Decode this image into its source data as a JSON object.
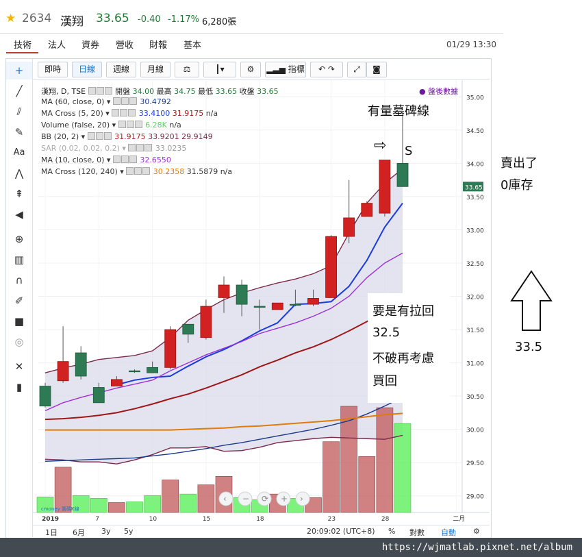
{
  "header": {
    "star_icon": "star-icon",
    "stock_code": "2634",
    "stock_name": "漢翔",
    "price": "33.65",
    "change": "-0.40",
    "change_pct": "-1.17%",
    "volume": "6,280張",
    "datetime": "01/29 13:30"
  },
  "tabs": [
    "技術",
    "法人",
    "資券",
    "營收",
    "財報",
    "基本"
  ],
  "toolbar": {
    "periods": [
      "即時",
      "日線",
      "週線",
      "月線"
    ],
    "indicator_label": "指標",
    "active_period": "日線"
  },
  "chart_header": {
    "symbol": "漢翔, D, TSE",
    "ohlc_labels": [
      "開盤",
      "最高",
      "最低",
      "收盤"
    ],
    "ohlc_values": [
      "34.00",
      "34.75",
      "33.65",
      "33.65"
    ],
    "compare_label": "盤後數據"
  },
  "indicators": [
    {
      "name": "MA (60, close, 0)",
      "values": [
        "30.4792"
      ],
      "colors": [
        "#1a3a8a"
      ]
    },
    {
      "name": "MA Cross (5, 20)",
      "values": [
        "33.4100",
        "31.9175",
        "n/a"
      ],
      "colors": [
        "#1a3adf",
        "#a01515",
        "#333333"
      ]
    },
    {
      "name": "Volume (false, 20)",
      "values": [
        "6.28K",
        "n/a"
      ],
      "colors": [
        "#5cd65c",
        "#333333"
      ]
    },
    {
      "name": "BB (20, 2)",
      "values": [
        "31.9175",
        "33.9201",
        "29.9149"
      ],
      "colors": [
        "#b22222",
        "#7a2a4a",
        "#7a2a4a"
      ]
    },
    {
      "name": "SAR (0.02, 0.02, 0.2)",
      "values": [
        "33.0235"
      ],
      "colors": [
        "#9a9a9a"
      ]
    },
    {
      "name": "MA (10, close, 0)",
      "values": [
        "32.6550"
      ],
      "colors": [
        "#9b30d9"
      ]
    },
    {
      "name": "MA Cross (120, 240)",
      "values": [
        "30.2358",
        "31.5879",
        "n/a"
      ],
      "colors": [
        "#e07b0a",
        "#333333",
        "#333333"
      ]
    }
  ],
  "annotations": {
    "tombstone": "有量墓碑線",
    "s_mark": "S",
    "sold": "賣出了",
    "zero_stock": "0庫存",
    "pullback_lines": [
      "要是有拉回",
      "32.5",
      "不破再考慮",
      "買回"
    ],
    "up_target": "33.5"
  },
  "bottom_bar": {
    "ranges": [
      "1日",
      "6月",
      "3y",
      "5y"
    ],
    "time": "20:09:02 (UTC+8)",
    "percent": "%",
    "log": "對數",
    "auto": "自動"
  },
  "watermark": "https://wjmatlab.pixnet.net/album",
  "logo_text": "cmoney 籌碼K線",
  "chart_data": {
    "type": "candlestick",
    "price_axis": {
      "ticks": [
        "35.00",
        "34.50",
        "34.00",
        "33.50",
        "33.00",
        "32.50",
        "32.00",
        "31.50",
        "31.00",
        "30.50",
        "30.00",
        "29.50",
        "29.00"
      ],
      "ylim": [
        28.75,
        35.25
      ]
    },
    "current_price_tag": "33.65",
    "x_ticks": [
      "2019",
      "7",
      "10",
      "15",
      "18",
      "23",
      "28",
      "二月"
    ],
    "candles": [
      {
        "o": 30.65,
        "h": 30.7,
        "l": 30.33,
        "c": 30.35,
        "v": 1.1
      },
      {
        "o": 30.73,
        "h": 31.55,
        "l": 30.7,
        "c": 31.02,
        "v": 3.2
      },
      {
        "o": 31.15,
        "h": 31.25,
        "l": 30.75,
        "c": 30.8,
        "v": 1.2
      },
      {
        "o": 30.63,
        "h": 30.7,
        "l": 30.4,
        "c": 30.4,
        "v": 1.0
      },
      {
        "o": 30.65,
        "h": 30.8,
        "l": 30.65,
        "c": 30.75,
        "v": 0.7
      },
      {
        "o": 30.88,
        "h": 30.9,
        "l": 30.85,
        "c": 30.88,
        "v": 0.75
      },
      {
        "o": 30.93,
        "h": 31.02,
        "l": 30.85,
        "c": 30.85,
        "v": 1.2
      },
      {
        "o": 30.93,
        "h": 31.55,
        "l": 30.9,
        "c": 31.5,
        "v": 2.3
      },
      {
        "o": 31.58,
        "h": 31.58,
        "l": 31.3,
        "c": 31.43,
        "v": 1.3
      },
      {
        "o": 31.38,
        "h": 31.95,
        "l": 31.35,
        "c": 31.85,
        "v": 1.95
      },
      {
        "o": 31.98,
        "h": 32.3,
        "l": 31.75,
        "c": 32.17,
        "v": 2.55
      },
      {
        "o": 32.17,
        "h": 32.25,
        "l": 31.7,
        "c": 31.88,
        "v": 1.05
      },
      {
        "o": 31.85,
        "h": 31.95,
        "l": 31.5,
        "c": 31.85,
        "v": 0.9
      },
      {
        "o": 31.8,
        "h": 31.9,
        "l": 31.8,
        "c": 31.9,
        "v": 1.3
      },
      {
        "o": 31.88,
        "h": 32.1,
        "l": 31.85,
        "c": 31.87,
        "v": 1.0
      },
      {
        "o": 31.88,
        "h": 32.1,
        "l": 31.85,
        "c": 31.97,
        "v": 1.05
      },
      {
        "o": 31.98,
        "h": 32.92,
        "l": 31.98,
        "c": 32.9,
        "v": 5.0
      },
      {
        "o": 32.9,
        "h": 33.75,
        "l": 32.8,
        "c": 33.18,
        "v": 7.5
      },
      {
        "o": 33.2,
        "h": 33.43,
        "l": 33.2,
        "c": 33.4,
        "v": 3.95
      },
      {
        "o": 33.25,
        "h": 34.05,
        "l": 33.2,
        "c": 34.05,
        "v": 7.4
      },
      {
        "o": 34.0,
        "h": 34.75,
        "l": 33.65,
        "c": 33.65,
        "v": 6.28
      }
    ],
    "series": [
      {
        "name": "MA (5)",
        "color": "#1a3adf",
        "values": [
          null,
          null,
          null,
          null,
          30.67,
          30.74,
          30.78,
          30.8,
          30.95,
          31.09,
          31.2,
          31.33,
          31.48,
          31.6,
          31.88,
          31.89,
          31.92,
          32.15,
          32.54,
          33.04,
          33.4
        ]
      },
      {
        "name": "MA (10)",
        "color": "#9b30d9",
        "values": [
          30.28,
          30.4,
          30.48,
          30.55,
          30.62,
          30.68,
          30.74,
          30.88,
          31.0,
          31.12,
          31.22,
          31.32,
          31.44,
          31.52,
          31.6,
          31.7,
          31.82,
          32.0,
          32.28,
          32.5,
          32.65
        ]
      },
      {
        "name": "BB mid (20)",
        "color": "#a01515",
        "values": [
          30.15,
          30.16,
          30.18,
          30.21,
          30.25,
          30.31,
          30.38,
          30.46,
          30.53,
          30.62,
          30.72,
          30.82,
          30.94,
          31.04,
          31.15,
          31.24,
          31.35,
          31.48,
          31.62,
          31.78,
          31.92
        ]
      },
      {
        "name": "BB upper",
        "color": "#7a2a4a",
        "values": [
          30.85,
          30.92,
          30.98,
          31.05,
          31.08,
          31.11,
          31.18,
          31.38,
          31.64,
          31.8,
          31.95,
          32.05,
          32.13,
          32.2,
          32.26,
          32.34,
          32.46,
          32.95,
          33.4,
          33.7,
          33.92
        ]
      },
      {
        "name": "BB lower",
        "color": "#7a2a4a",
        "values": [
          29.55,
          29.54,
          29.51,
          29.51,
          29.48,
          29.54,
          29.62,
          29.72,
          29.72,
          29.74,
          29.67,
          29.68,
          29.73,
          29.8,
          29.83,
          29.86,
          29.88,
          29.87,
          29.86,
          29.85,
          29.91
        ]
      },
      {
        "name": "MA (60)",
        "color": "#1a3a8a",
        "values": [
          29.52,
          29.53,
          29.54,
          29.55,
          29.56,
          29.57,
          29.6,
          29.63,
          29.67,
          29.71,
          29.76,
          29.8,
          29.85,
          29.9,
          29.95,
          30.0,
          30.06,
          30.13,
          30.23,
          30.35,
          30.48
        ]
      },
      {
        "name": "MA (120)",
        "color": "#e07b0a",
        "values": [
          29.99,
          29.99,
          29.99,
          29.99,
          29.99,
          29.99,
          29.99,
          29.99,
          30.0,
          30.01,
          30.02,
          30.04,
          30.05,
          30.07,
          30.09,
          30.11,
          30.13,
          30.16,
          30.19,
          30.22,
          30.24
        ]
      }
    ]
  }
}
